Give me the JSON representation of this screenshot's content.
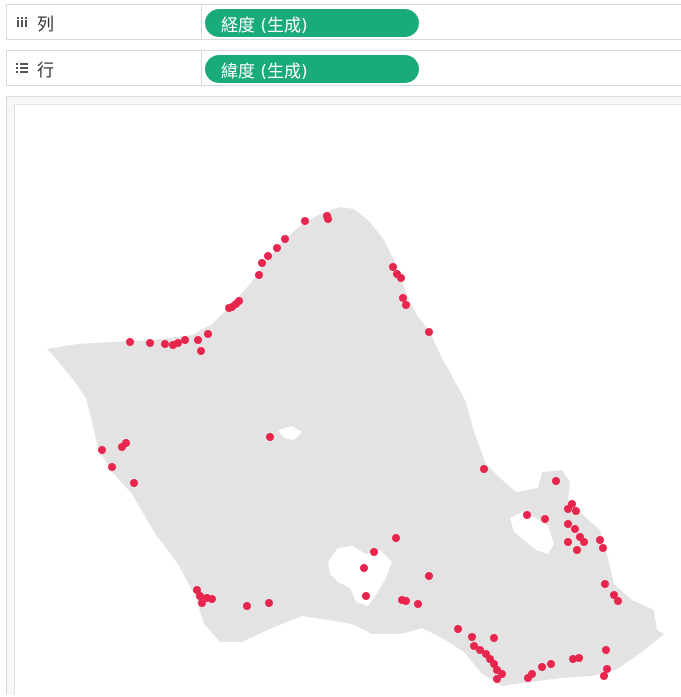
{
  "shelves": {
    "columns": {
      "label": "列",
      "pill": "経度 (生成)",
      "icon": "columns-icon"
    },
    "rows": {
      "label": "行",
      "pill": "緯度 (生成)",
      "icon": "rows-icon"
    }
  },
  "map": {
    "land_color": "#e3e3e3",
    "mark_color": "#e8254d",
    "background_color": "#ffffff"
  }
}
